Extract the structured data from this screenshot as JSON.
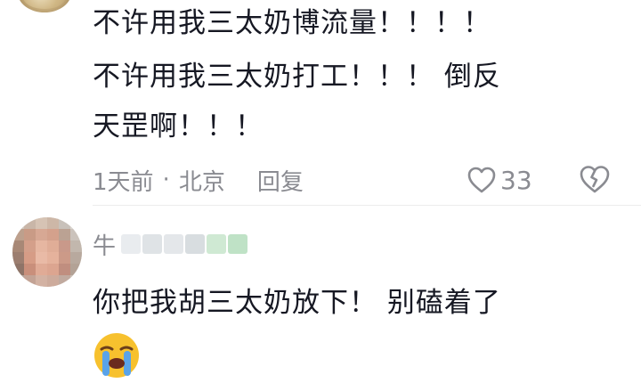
{
  "comment1": {
    "lines": [
      "不许用我三太奶博流量！！！！",
      "不许用我三太奶打工！！！ 倒反",
      "天罡啊！！！"
    ],
    "time": "1天前",
    "separator": "·",
    "location": "北京",
    "reply_label": "回复",
    "like_count": "33"
  },
  "comment2": {
    "user_name_visible": "牛",
    "text": "你把我胡三太奶放下！ 别磕着了",
    "emoji_icon": "loudly-crying-face-icon"
  },
  "colors": {
    "text": "#161823",
    "meta": "#8a8b91",
    "emoji_face": "#f7c12e",
    "tear": "#5aa3e8"
  }
}
